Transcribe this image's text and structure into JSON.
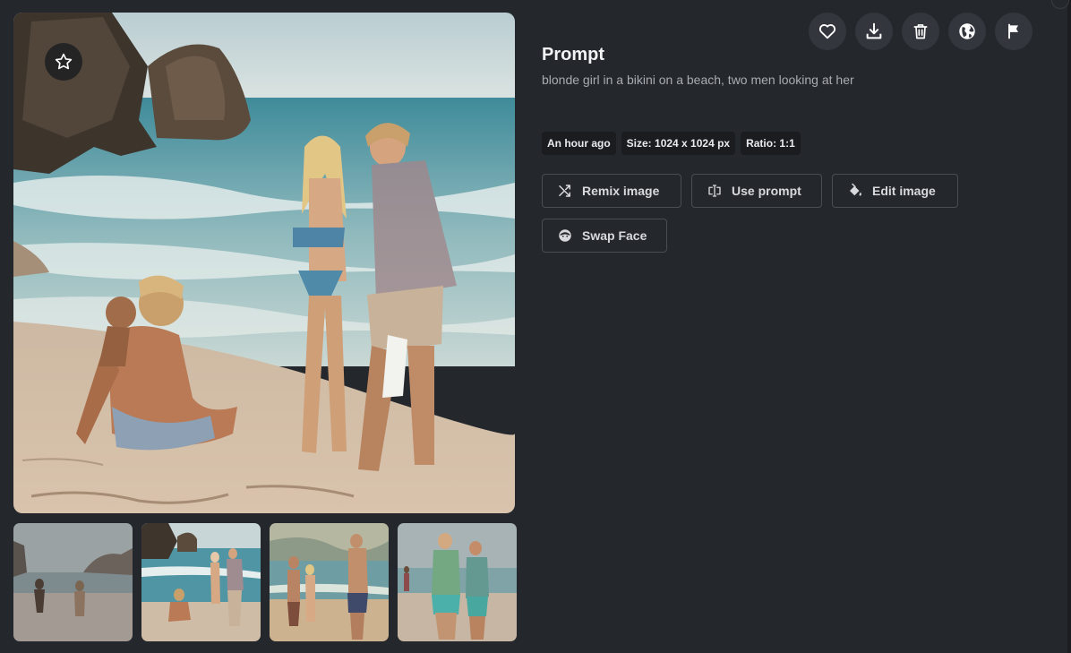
{
  "prompt": {
    "title": "Prompt",
    "text": "blonde girl in a bikini on a beach, two men looking at her"
  },
  "meta": {
    "time": "An hour ago",
    "size": "Size: 1024 x 1024 px",
    "ratio": "Ratio: 1:1"
  },
  "buttons": {
    "remix": "Remix image",
    "use_prompt": "Use prompt",
    "edit": "Edit image",
    "swap_face": "Swap Face"
  },
  "actions": [
    "heart-icon",
    "download-icon",
    "trash-icon",
    "globe-icon",
    "flag-icon"
  ],
  "colors": {
    "background": "#24272c",
    "action_button": "#33363c",
    "badge_background": "#1a1c20",
    "button_border": "#4a4d54"
  }
}
